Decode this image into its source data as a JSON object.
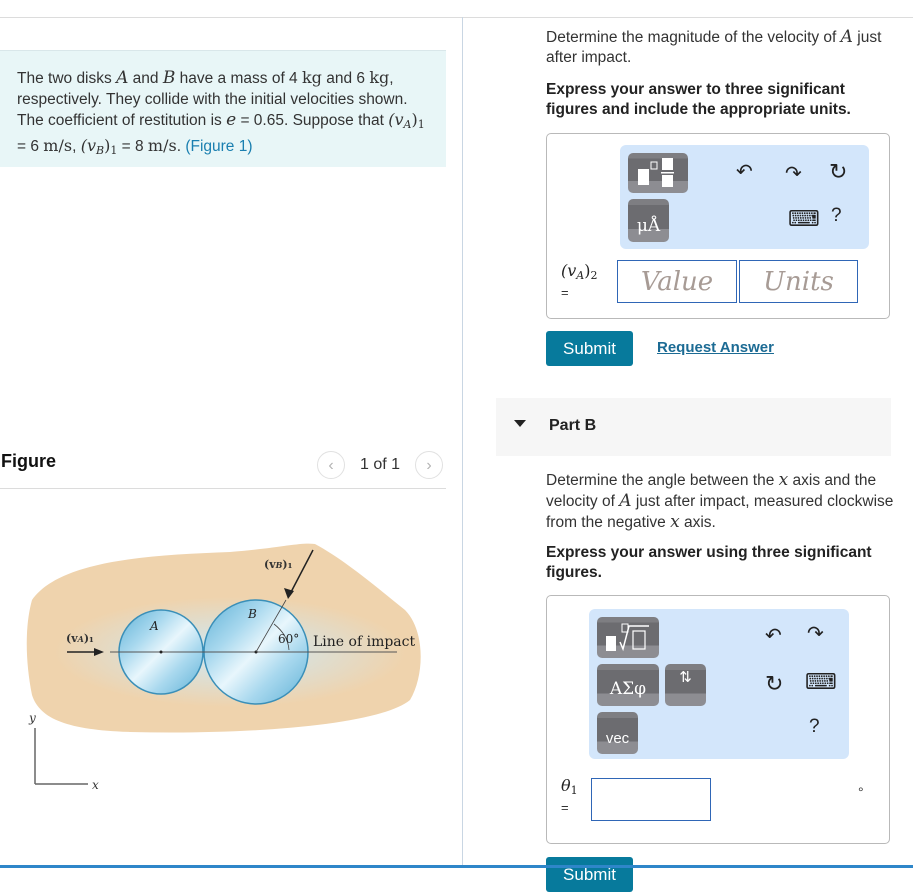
{
  "problem": {
    "t1": "The two disks ",
    "A": "A",
    "t2": " and ",
    "B": "B",
    "t3": " have a mass of 4 ",
    "kg": "kg",
    "t4": " and 6 ",
    "kg2": "kg",
    "t5": ", respectively. They collide with the initial velocities shown. The coefficient of restitution is ",
    "e": "e",
    "t6": " = 0.65. Suppose that ",
    "vA": "(v",
    "vA_sub": "A",
    "vA_close": ")",
    "vA_idx": "1",
    "vA_val": " = 6 ",
    "unit_ms": "m/s",
    "sep": ", ",
    "vB": "(v",
    "vB_sub": "B",
    "vB_close": ")",
    "vB_idx": "1",
    "vB_val": " = 8 ",
    "unit_ms2": "m/s",
    "t7": ". ",
    "figure_link": "(Figure 1)"
  },
  "figure": {
    "title": "Figure",
    "pager_text": "1 of 1",
    "prev_icon": "‹",
    "next_icon": "›",
    "labels": {
      "vA1": "(v",
      "vA1_sub": "A",
      "vA1_end": ")₁",
      "vB1": "(v",
      "vB1_sub": "B",
      "vB1_end": ")₁",
      "disk_a": "A",
      "disk_b": "B",
      "angle": "60°",
      "line_of_impact": "Line of impact",
      "axis_y": "y",
      "axis_x": "x"
    },
    "colors": {
      "surface": "#efd3ad",
      "glow": "#bfe3f3",
      "disk": "#7cc2e0",
      "disk_edge": "#3a8fb8"
    }
  },
  "partA": {
    "question_1": "Determine the magnitude of the velocity of ",
    "question_var": "A",
    "question_2": " just after impact.",
    "instruction": "Express your answer to three significant figures and include the appropriate units.",
    "toolbar": {
      "template_icon": "fraction-template",
      "units_label": "μÅ",
      "undo": "↶",
      "redo": "↷",
      "reset": "↻",
      "keyboard": "⌨",
      "help": "?"
    },
    "label": "(v",
    "label_sub": "A",
    "label_end": ")",
    "label_idx": "2",
    "equals": "=",
    "value_placeholder": "Value",
    "units_placeholder": "Units",
    "submit": "Submit",
    "request_answer": "Request Answer"
  },
  "partB": {
    "title": "Part B",
    "question_1": "Determine the angle between the ",
    "x1": "x",
    "question_2": " axis and the velocity of ",
    "var": "A",
    "question_3": " just after impact, measured clockwise from the negative ",
    "x2": "x",
    "question_4": " axis.",
    "instruction": "Express your answer using three significant figures.",
    "toolbar": {
      "template_icon": "root-template",
      "greek_label": "ΑΣφ",
      "arrows_label": "⇅",
      "vec_label": "vec",
      "undo": "↶",
      "redo": "↷",
      "reset": "↻",
      "keyboard": "⌨",
      "help": "?"
    },
    "label": "θ",
    "label_idx": "1",
    "equals": "=",
    "value": "",
    "unit_symbol": "°",
    "submit": "Submit"
  },
  "colors": {
    "accent": "#077a9c",
    "link": "#1a7fb0",
    "input_border": "#2f66b6",
    "toolbar_bg": "#d3e6fb",
    "problem_bg": "#e8f6f7"
  }
}
